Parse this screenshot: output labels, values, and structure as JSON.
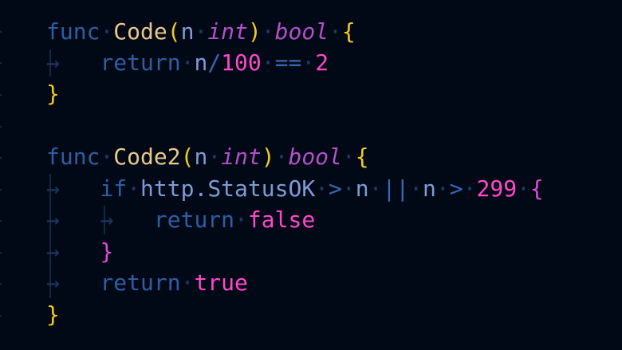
{
  "code": {
    "l1": {
      "kw": "func",
      "fn": "Code",
      "p_open": "(",
      "p_name": "n",
      "p_type": "int",
      "p_close": ")",
      "ret": "bool",
      "brace": "{"
    },
    "l2": {
      "kw": "return",
      "var": "n",
      "slash": "/",
      "num1": "100",
      "eq": "==",
      "num2": "2"
    },
    "l3": {
      "brace": "}"
    },
    "l5": {
      "kw": "func",
      "fn": "Code2",
      "p_open": "(",
      "p_name": "n",
      "p_type": "int",
      "p_close": ")",
      "ret": "bool",
      "brace": "{"
    },
    "l6": {
      "kw": "if",
      "pkg": "http",
      "dot": ".",
      "const": "StatusOK",
      "gt1": ">",
      "var1": "n",
      "or": "||",
      "var2": "n",
      "gt2": ">",
      "num": "299",
      "brace": "{"
    },
    "l7": {
      "kw": "return",
      "val": "false"
    },
    "l8": {
      "brace": "}"
    },
    "l9": {
      "kw": "return",
      "val": "true"
    },
    "l10": {
      "brace": "}"
    }
  },
  "glyphs": {
    "space_dot": "·",
    "tab_arrow": "→"
  },
  "colors": {
    "background": "#020916",
    "keyword": "#2e5da3",
    "function": "#e8c88a",
    "type": "#b34fc9",
    "bracket_outer": "#f2cc1b",
    "bracket_inner": "#e04bd8",
    "number": "#ff47c9"
  }
}
